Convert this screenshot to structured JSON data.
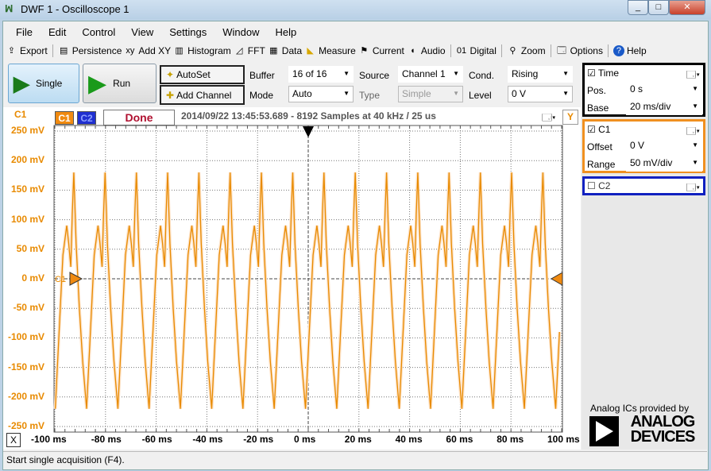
{
  "window": {
    "title": "DWF 1 - Oscilloscope 1",
    "minimize": "_",
    "maximize": "□",
    "close": "✕"
  },
  "menu": [
    "File",
    "Edit",
    "Control",
    "View",
    "Settings",
    "Window",
    "Help"
  ],
  "toolbar": [
    {
      "label": "Export",
      "icon": "export-icon"
    },
    {
      "label": "Persistence",
      "icon": "persistence-icon"
    },
    {
      "label": "Add XY",
      "icon": "xy-icon"
    },
    {
      "label": "Histogram",
      "icon": "histogram-icon"
    },
    {
      "label": "FFT",
      "icon": "fft-icon"
    },
    {
      "label": "Data",
      "icon": "table-icon"
    },
    {
      "label": "Measure",
      "icon": "ruler-icon"
    },
    {
      "label": "Current",
      "icon": "flag-icon"
    },
    {
      "label": "Audio",
      "icon": "speaker-icon"
    },
    {
      "label": "Digital",
      "icon": "digital-icon"
    },
    {
      "label": "Zoom",
      "icon": "magnifier-icon"
    },
    {
      "label": "Options",
      "icon": "options-icon"
    },
    {
      "label": "Help",
      "icon": "help-icon"
    }
  ],
  "controls": {
    "single": "Single",
    "run": "Run",
    "autoset": "AutoSet",
    "add_channel": "Add Channel",
    "buffer_label": "Buffer",
    "buffer": "16 of 16",
    "mode_label": "Mode",
    "mode": "Auto",
    "source_label": "Source",
    "source": "Channel 1",
    "type_label": "Type",
    "type": "Simple",
    "cond_label": "Cond.",
    "cond": "Rising",
    "level_label": "Level",
    "level": "0 V"
  },
  "plot_header": {
    "channel_label": "C1",
    "c1": "C1",
    "c2": "C2",
    "status": "Done",
    "info": "2014/09/22 13:45:53.689 - 8192 Samples at 40 kHz / 25 us",
    "y_button": "Y",
    "x_button": "X",
    "trigger_label": "C1"
  },
  "right": {
    "time": {
      "title": "Time",
      "checked": true,
      "pos_label": "Pos.",
      "pos": "0 s",
      "base_label": "Base",
      "base": "20 ms/div"
    },
    "c1": {
      "title": "C1",
      "checked": true,
      "offset_label": "Offset",
      "offset": "0 V",
      "range_label": "Range",
      "range": "50 mV/div"
    },
    "c2": {
      "title": "C2",
      "checked": false
    },
    "ad_caption": "Analog ICs provided by",
    "ad_logo": "ANALOG DEVICES"
  },
  "status": "Start single acquisition (F4).",
  "colors": {
    "c1": "#e88a00",
    "c2": "#1020c0",
    "time_border": "#000000",
    "done": "#b01030"
  },
  "chart_data": {
    "type": "line",
    "series": [
      {
        "name": "C1",
        "color": "#e88a00"
      }
    ],
    "x_ticks": [
      "-100 ms",
      "-80 ms",
      "-60 ms",
      "-40 ms",
      "-20 ms",
      "0 ms",
      "20 ms",
      "40 ms",
      "60 ms",
      "80 ms",
      "100 ms"
    ],
    "y_ticks": [
      "250 mV",
      "200 mV",
      "150 mV",
      "100 mV",
      "50 mV",
      "0 mV",
      "-50 mV",
      "-100 mV",
      "-150 mV",
      "-200 mV",
      "-250 mV"
    ],
    "xlim_ms": [
      -100,
      100
    ],
    "ylim_mV": [
      -250,
      250
    ],
    "grid": true,
    "cycle_period_ms": 12.34,
    "first_trough_ms": -99.8,
    "cycle_shape": {
      "t_ms": [
        0,
        1.5,
        3,
        4.5,
        5.3,
        6.1,
        6.7,
        7.3,
        8.2,
        9.5,
        10.8,
        12.34
      ],
      "mV": [
        -220,
        -90,
        40,
        90,
        60,
        20,
        110,
        180,
        60,
        -50,
        -140,
        -220
      ]
    }
  }
}
